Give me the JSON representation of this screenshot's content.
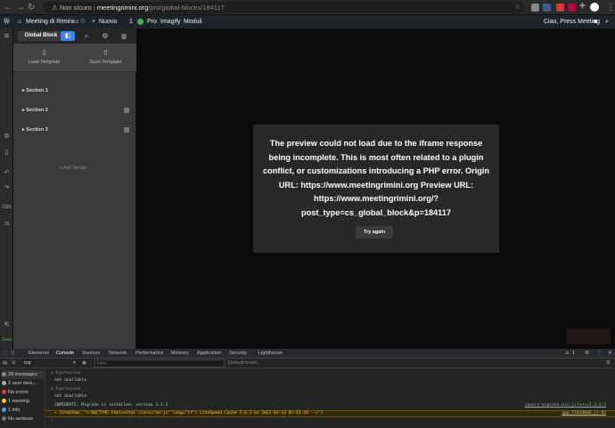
{
  "browser": {
    "not_secure": "Non sicuro",
    "url_host": "meetingrimini.org",
    "url_path": "/pro/global-blocks/184117"
  },
  "wpbar": {
    "site": "Meeting di Rimini",
    "comments": "0",
    "new": "Nuovo",
    "updates": "1",
    "pro": "Pro",
    "imagify": "Imagify",
    "moduli": "Moduli",
    "greeting": "Ciao, Press Meeting"
  },
  "rail": {
    "css": "CSS",
    "js": "JS",
    "save": "Save"
  },
  "panel": {
    "tab": "Global Block",
    "load_template": "Load Template",
    "save_template": "Save Template",
    "sections": [
      "Section 1",
      "Section 2",
      "Section 3"
    ],
    "add_section": "+ Add Section"
  },
  "preview": {
    "error": "The preview could not load due to the iframe response being incomplete. This is most often related to a plugin conflict, or customizations introducing a PHP error. Origin URL: https://www.meetingrimini.org Preview URL: https://www.meetingrimini.org/?post_type=cs_global_block&p=184117",
    "try_again": "Try again"
  },
  "devtools": {
    "tabs": [
      "Elements",
      "Console",
      "Sources",
      "Network",
      "Performance",
      "Memory",
      "Application",
      "Security",
      "Lighthouse"
    ],
    "active_tab": "Console",
    "warning_count": "1",
    "context": "top",
    "filter_placeholder": "Filter",
    "levels": "Default levels",
    "sidebar": [
      "28 messages",
      "2 user mes...",
      "No errors",
      "1 warning",
      "1 info",
      "No verbose"
    ],
    "expr1_label": "Expression",
    "expr1_value": "not available",
    "expr2_label": "Expression",
    "expr2_value": "not available",
    "log_jquery": "JQMIGRATE: Migrate is installed, version 3.3.2",
    "log_jquery_src": "jquery-migrate.min.js?ver=3.3.2:2",
    "log_warn": "▸ {htmlRaw: \"<!DOCTYPE html><html class=\"no-js\" lang=\"it\"> LiteSpeed Cache 3.6.3 on 2021-03-13 01:43:44 -->\"}",
    "log_warn_src": "app.f2d1d8d6.js:42"
  }
}
